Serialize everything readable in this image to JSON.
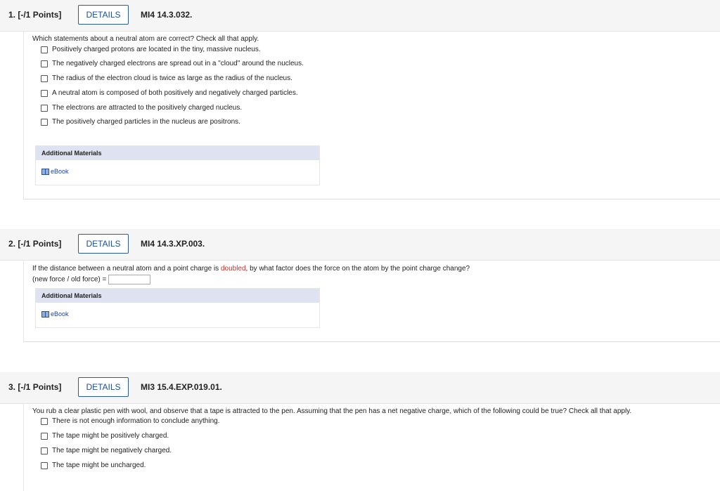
{
  "questions": [
    {
      "number": "1.",
      "points": "[-/1 Points]",
      "details_label": "DETAILS",
      "code": "MI4 14.3.032.",
      "prompt": "Which statements about a neutral atom are correct? Check all that apply.",
      "options": [
        "Positively charged protons are located in the tiny, massive nucleus.",
        "The negatively charged electrons are spread out in a \"cloud\" around the nucleus.",
        "The radius of the electron cloud is twice as large as the radius of the nucleus.",
        "A neutral atom is composed of both positively and negatively charged particles.",
        "The electrons are attracted to the positively charged nucleus.",
        "The positively charged particles in the nucleus are positrons."
      ],
      "materials_title": "Additional Materials",
      "ebook_label": "eBook"
    },
    {
      "number": "2.",
      "points": "[-/1 Points]",
      "details_label": "DETAILS",
      "code": "MI4 14.3.XP.003.",
      "prompt_before": "If the distance between a neutral atom and a point charge is ",
      "prompt_highlight": "doubled",
      "prompt_after": ", by what factor does the force on the atom by the point charge change?",
      "answer_label": "(new force / old force) =",
      "answer_value": "",
      "materials_title": "Additional Materials",
      "ebook_label": "eBook"
    },
    {
      "number": "3.",
      "points": "[-/1 Points]",
      "details_label": "DETAILS",
      "code": "MI3 15.4.EXP.019.01.",
      "prompt": "You rub a clear plastic pen with wool, and observe that a tape is attracted to the pen. Assuming that the pen has a net negative charge, which of the following could be true? Check all that apply.",
      "options": [
        "There is not enough information to conclude anything.",
        "The tape might be positively charged.",
        "The tape might be negatively charged.",
        "The tape might be uncharged."
      ]
    }
  ],
  "colors": {
    "details_border": "#2a5a9c",
    "highlight": "#d0302a",
    "materials_header": "#dfe3f1",
    "link": "#1a44a6"
  }
}
